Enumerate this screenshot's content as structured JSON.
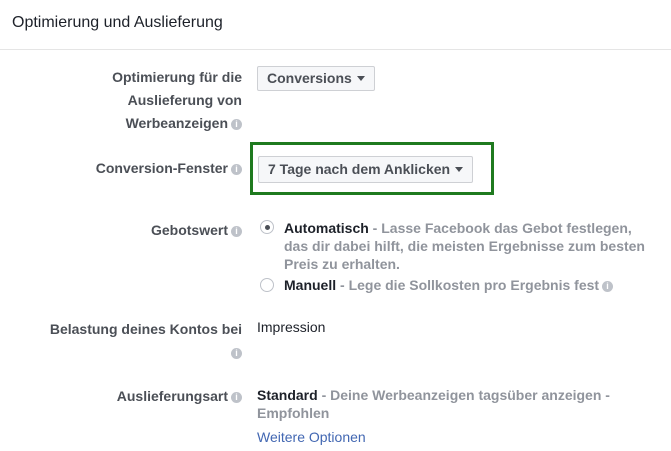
{
  "header": {
    "title": "Optimierung und Auslieferung"
  },
  "optimization": {
    "label_line1": "Optimierung für die",
    "label_line2": "Auslieferung von",
    "label_line3": "Werbeanzeigen",
    "value": "Conversions"
  },
  "conversion_window": {
    "label": "Conversion-Fenster",
    "value": "7 Tage nach dem Anklicken"
  },
  "bid": {
    "label": "Gebotswert",
    "automatic": {
      "title": "Automatisch",
      "desc_line1": " - Lasse Facebook das Gebot festlegen,",
      "desc_line2": "das dir dabei hilft, die meisten Ergebnisse zum besten",
      "desc_line3": "Preis zu erhalten.",
      "selected": true
    },
    "manual": {
      "title": "Manuell",
      "desc": " - Lege die Sollkosten pro Ergebnis fest",
      "selected": false
    }
  },
  "charge": {
    "label": "Belastung deines Kontos bei",
    "value": "Impression"
  },
  "delivery": {
    "label": "Auslieferungsart",
    "value_title": "Standard",
    "value_desc": " - Deine Werbeanzeigen tagsüber anzeigen -",
    "value_desc2": "Empfohlen",
    "more_link": "Weitere Optionen"
  },
  "icons": {
    "info": "info-icon",
    "caret": "caret-down-icon",
    "radio": "radio-icon"
  },
  "colors": {
    "highlight_border": "#1f7a1f",
    "link": "#4267b2",
    "muted": "#90949c"
  }
}
